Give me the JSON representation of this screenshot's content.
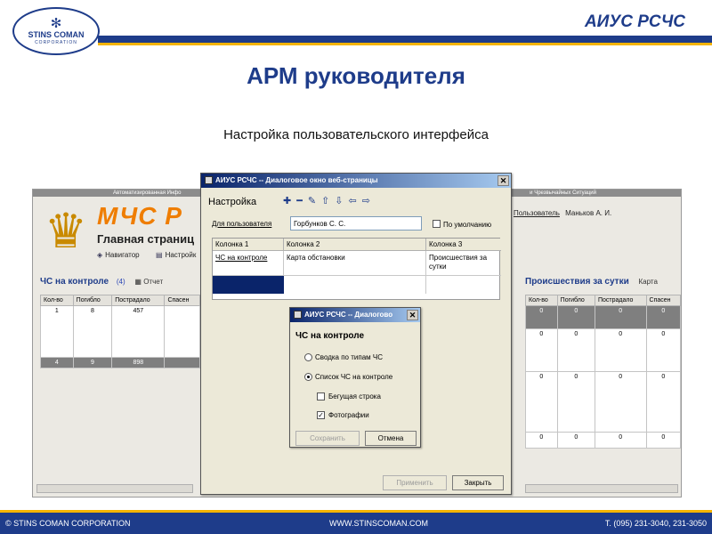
{
  "header": {
    "logo_emblem": "✻",
    "logo_name": "STINS COMAN",
    "logo_corp": "CORPORATION",
    "brand": "АИУС РСЧС"
  },
  "title": "АРМ руководителя",
  "subtitle": "Настройка пользовательского интерфейса",
  "bg_app": {
    "top_strip_left": "Автоматизированная Инфо",
    "top_strip_right": "и Чрезвычайных Ситуаций",
    "logo_text": "МЧС Р",
    "main_page": "Главная страниц",
    "nav": [
      {
        "icon": "navigator-icon",
        "label": "Навигатор"
      },
      {
        "icon": "settings-icon",
        "label": "Настройк"
      }
    ],
    "user_label": "Пользователь",
    "user_name": "Маньков А. И.",
    "left_section": {
      "title": "ЧС на контроле",
      "count": "(4)",
      "report": "Отчет"
    },
    "left_table": {
      "headers": [
        "Кол-во",
        "Погибло",
        "Пострадало",
        "Спасен"
      ],
      "rows": [
        [
          "1",
          "8",
          "457",
          ""
        ]
      ],
      "total": [
        "4",
        "9",
        "898",
        ""
      ]
    },
    "right_section": {
      "title": "Происшествия за сутки",
      "map": "Карта"
    },
    "right_table": {
      "headers": [
        "Кол-во",
        "Погибло",
        "Пострадало",
        "Спасен"
      ],
      "rows": [
        [
          "0",
          "0",
          "0",
          "0"
        ],
        [
          "0",
          "0",
          "0",
          "0"
        ],
        [
          "0",
          "0",
          "0",
          "0"
        ],
        [
          "0",
          "0",
          "0",
          "0"
        ]
      ]
    }
  },
  "dialog1": {
    "title": "АИУС РСЧС -- Диалоговое окно веб-страницы",
    "heading": "Настройка",
    "toolbar_icons": [
      "add-icon",
      "remove-icon",
      "edit-icon",
      "move-up-icon",
      "move-down-icon",
      "move-left-icon",
      "move-right-icon"
    ],
    "toolbar_glyphs": [
      "✚",
      "━",
      "✎",
      "⇧",
      "⇩",
      "⇦",
      "⇨"
    ],
    "user_label": "Для пользователя",
    "user_value": "Горбунков С. С.",
    "default_label": "По умолчанию",
    "columns": [
      "Колонка 1",
      "Колонка 2",
      "Колонка 3"
    ],
    "cells": [
      "ЧС на контроле",
      "Карта обстановки",
      "Происшествия за сутки"
    ],
    "apply": "Применить",
    "close": "Закрыть"
  },
  "dialog2": {
    "title": "АИУС РСЧС -- Диалогово",
    "heading": "ЧС на контроле",
    "options": [
      {
        "label": "Сводка по типам ЧС",
        "selected": false
      },
      {
        "label": "Список ЧС на контроле",
        "selected": true
      }
    ],
    "checks": [
      {
        "label": "Бегущая строка",
        "checked": false
      },
      {
        "label": "Фотографии",
        "checked": true
      }
    ],
    "save": "Сохранить",
    "cancel": "Отмена"
  },
  "footer": {
    "left": "© STINS COMAN CORPORATION",
    "center": "WWW.STINSCOMAN.COM",
    "right": "Т. (095) 231-3040, 231-3050"
  },
  "colors": {
    "brand_blue": "#1e3c8a",
    "accent_yellow": "#f5b400",
    "mchs_orange": "#ef7d00",
    "selected_row": "#0a246a"
  }
}
